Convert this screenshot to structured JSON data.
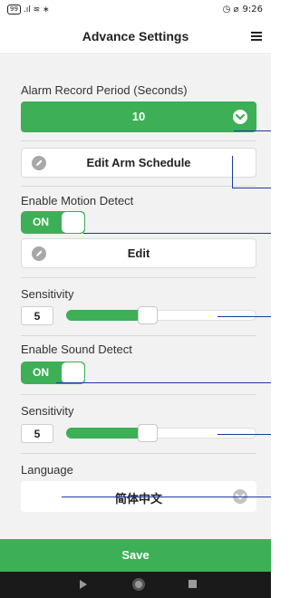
{
  "status_bar": {
    "left_chip": "99",
    "left_glyphs": ".ıl ≋ ∗",
    "right_glyphs": "◷ ⌀",
    "time": "9:26"
  },
  "header": {
    "title": "Advance Settings",
    "menu_icon": "hamburger-menu-icon"
  },
  "alarm_record": {
    "label": "Alarm Record Period (Seconds)",
    "value": "10"
  },
  "arm_schedule": {
    "label": "Edit Arm Schedule"
  },
  "motion": {
    "label": "Enable Motion Detect",
    "toggle_text": "ON",
    "edit_label": "Edit",
    "sensitivity_label": "Sensitivity",
    "sensitivity_value": "5",
    "sensitivity_fraction": 0.42
  },
  "sound": {
    "label": "Enable Sound Detect",
    "toggle_text": "ON",
    "sensitivity_label": "Sensitivity",
    "sensitivity_value": "5",
    "sensitivity_fraction": 0.42
  },
  "language": {
    "label": "Language",
    "value": "简体中文"
  },
  "footer": {
    "save_label": "Save"
  },
  "colors": {
    "accent": "#3daf57",
    "annotation_line": "#1b3aa0"
  }
}
